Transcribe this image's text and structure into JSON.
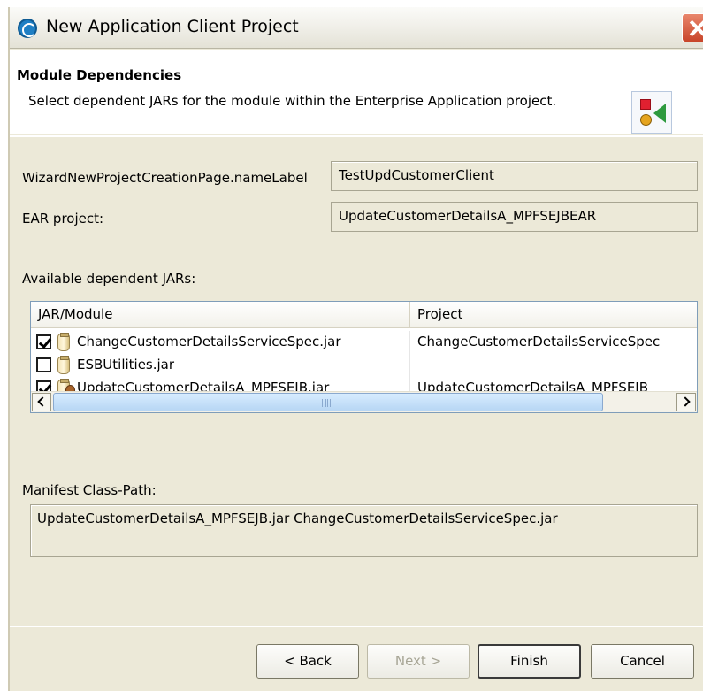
{
  "window": {
    "title": "New Application Client Project"
  },
  "header": {
    "title": "Module Dependencies",
    "description": "Select dependent JARs for the module within the Enterprise Application project."
  },
  "form": {
    "name_label": "WizardNewProjectCreationPage.nameLabel",
    "name_value": "TestUpdCustomerClient",
    "ear_label": "EAR project:",
    "ear_value": "UpdateCustomerDetailsA_MPFSEJBEAR"
  },
  "jars": {
    "section_label": "Available dependent JARs:",
    "columns": [
      "JAR/Module",
      "Project"
    ],
    "rows": [
      {
        "checked": true,
        "icon": "jar-icon",
        "jar": "ChangeCustomerDetailsServiceSpec.jar",
        "project": "ChangeCustomerDetailsServiceSpec"
      },
      {
        "checked": false,
        "icon": "jar-icon",
        "jar": "ESBUtilities.jar",
        "project": ""
      },
      {
        "checked": true,
        "icon": "ejb-jar-icon",
        "jar": "UpdateCustomerDetailsA_MPFSEJB.jar",
        "project": "UpdateCustomerDetailsA_MPFSEJB"
      }
    ]
  },
  "manifest": {
    "label": "Manifest Class-Path:",
    "value": "UpdateCustomerDetailsA_MPFSEJB.jar ChangeCustomerDetailsServiceSpec.jar"
  },
  "buttons": {
    "back": "< Back",
    "next": "Next >",
    "finish": "Finish",
    "cancel": "Cancel"
  }
}
